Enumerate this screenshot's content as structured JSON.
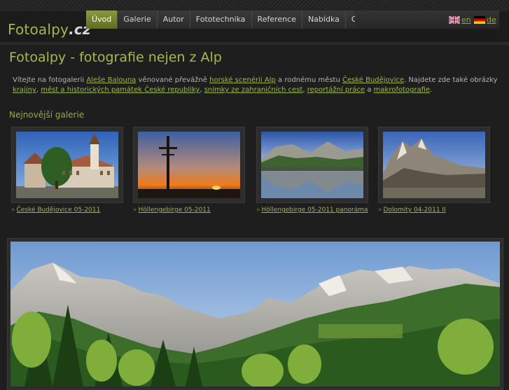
{
  "site": {
    "logo_main": "Fotoalpy",
    "logo_tld": ".cz"
  },
  "nav": {
    "items": [
      {
        "label": "Úvod",
        "active": true
      },
      {
        "label": "Galerie"
      },
      {
        "label": "Autor"
      },
      {
        "label": "Fototechnika"
      },
      {
        "label": "Reference"
      },
      {
        "label": "Nabídka"
      },
      {
        "label": "Odkazy"
      }
    ]
  },
  "languages": [
    {
      "code": "en",
      "flag": "uk-flag-icon"
    },
    {
      "code": "de",
      "flag": "germany-flag-icon"
    }
  ],
  "page": {
    "title": "Fotoalpy - fotografie nejen z Alp",
    "intro": {
      "t1": "Vítejte na fotogalerii ",
      "l1": "Aleše Balouna",
      "t2": " věnované převážně ",
      "l2": "horské scenérii Alp",
      "t3": " a rodnému městu ",
      "l3": "České Budějovice",
      "t4": ". Najdete zde také obrázky ",
      "l4": "krajiny",
      "t5": ", ",
      "l5": "měst a historických památek České republiky",
      "t6": ", ",
      "l6": "snímky ze zahraničních cest",
      "t7": ", ",
      "l7": "reportážní práce",
      "t8": " a ",
      "l8": "makrofotografie",
      "t9": "."
    },
    "galleries_heading": "Nejnovější galerie",
    "galleries": [
      {
        "name": "České Budějovice 05-2011"
      },
      {
        "name": "Höllengebirge 05-2011"
      },
      {
        "name": "Höllengebirge 05-2011 panoráma"
      },
      {
        "name": "Dolomity 04-2011 II"
      }
    ]
  },
  "colors": {
    "accent": "#9db64b",
    "background": "#1e1e1e",
    "nav_active": "#7a8a30"
  }
}
